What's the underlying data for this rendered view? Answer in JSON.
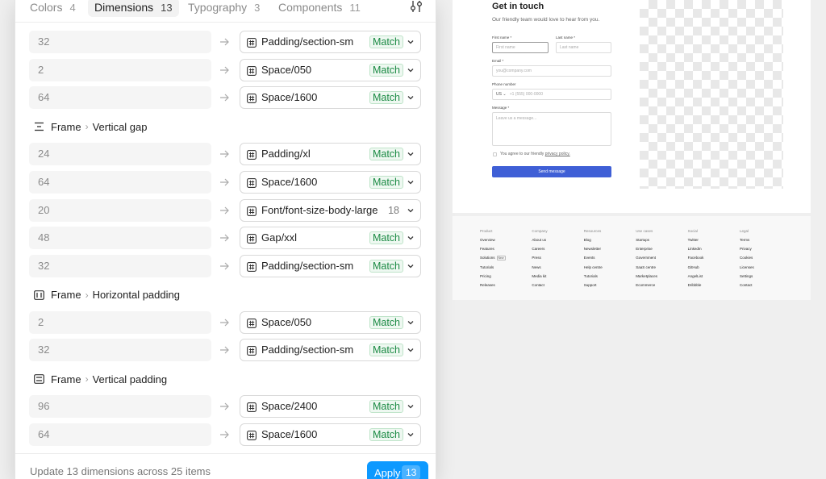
{
  "tabs": [
    {
      "label": "Colors",
      "count": "4"
    },
    {
      "label": "Dimensions",
      "count": "13"
    },
    {
      "label": "Typography",
      "count": "3"
    },
    {
      "label": "Components",
      "count": "11"
    }
  ],
  "list": {
    "top_rows": [
      {
        "value": "32",
        "token": "Padding/section-sm",
        "badge": "Match"
      },
      {
        "value": "2",
        "token": "Space/050",
        "badge": "Match"
      },
      {
        "value": "64",
        "token": "Space/1600",
        "badge": "Match"
      }
    ],
    "groups": [
      {
        "frame": "Frame",
        "property": "Vertical gap",
        "icon": "vertical-gap-icon",
        "rows": [
          {
            "value": "24",
            "token": "Padding/xl",
            "badge": "Match"
          },
          {
            "value": "64",
            "token": "Space/1600",
            "badge": "Match"
          },
          {
            "value": "20",
            "token": "Font/font-size-body-large",
            "number": "18"
          },
          {
            "value": "48",
            "token": "Gap/xxl",
            "badge": "Match"
          },
          {
            "value": "32",
            "token": "Padding/section-sm",
            "badge": "Match"
          }
        ]
      },
      {
        "frame": "Frame",
        "property": "Horizontal padding",
        "icon": "horizontal-padding-icon",
        "rows": [
          {
            "value": "2",
            "token": "Space/050",
            "badge": "Match"
          },
          {
            "value": "32",
            "token": "Padding/section-sm",
            "badge": "Match"
          }
        ]
      },
      {
        "frame": "Frame",
        "property": "Vertical padding",
        "icon": "vertical-padding-icon",
        "rows": [
          {
            "value": "96",
            "token": "Space/2400",
            "badge": "Match"
          },
          {
            "value": "64",
            "token": "Space/1600",
            "badge": "Match"
          }
        ]
      }
    ]
  },
  "footer": {
    "summary": "Update 13 dimensions across 25 items",
    "apply_label": "Apply",
    "apply_count": "13"
  },
  "page_preview": {
    "title": "Get in touch",
    "subtitle": "Our friendly team would love to hear from you.",
    "first_name_label": "First name *",
    "first_name_placeholder": "First name",
    "last_name_label": "Last name *",
    "last_name_placeholder": "Last name",
    "email_label": "Email *",
    "email_placeholder": "you@company.com",
    "phone_label": "Phone number",
    "phone_prefix": "US ⌄",
    "phone_placeholder": "+1 (555) 000-0000",
    "message_label": "Message *",
    "message_placeholder": "Leave us a message...",
    "agree_text": "You agree to our friendly",
    "agree_link": "privacy policy.",
    "send_label": "Send message",
    "footer_columns": [
      {
        "heading": "Product",
        "items": [
          "Overview",
          "Features",
          "Solutions",
          "Tutorials",
          "Pricing",
          "Releases"
        ]
      },
      {
        "heading": "Company",
        "items": [
          "About us",
          "Careers",
          "Press",
          "News",
          "Media kit",
          "Contact"
        ]
      },
      {
        "heading": "Resources",
        "items": [
          "Blog",
          "Newsletter",
          "Events",
          "Help centre",
          "Tutorials",
          "Support"
        ]
      },
      {
        "heading": "Use cases",
        "items": [
          "Startups",
          "Enterprise",
          "Government",
          "SaaS centre",
          "Marketplaces",
          "Ecommerce"
        ]
      },
      {
        "heading": "Social",
        "items": [
          "Twitter",
          "LinkedIn",
          "Facebook",
          "GitHub",
          "AngelList",
          "Dribbble"
        ]
      },
      {
        "heading": "Legal",
        "items": [
          "Terms",
          "Privacy",
          "Cookies",
          "Licenses",
          "Settings",
          "Contact"
        ]
      }
    ],
    "new_badge": "New"
  },
  "colors": {
    "accent": "#0d99ff",
    "match_green": "#1a8a43",
    "send_button": "#3f5fd6"
  }
}
